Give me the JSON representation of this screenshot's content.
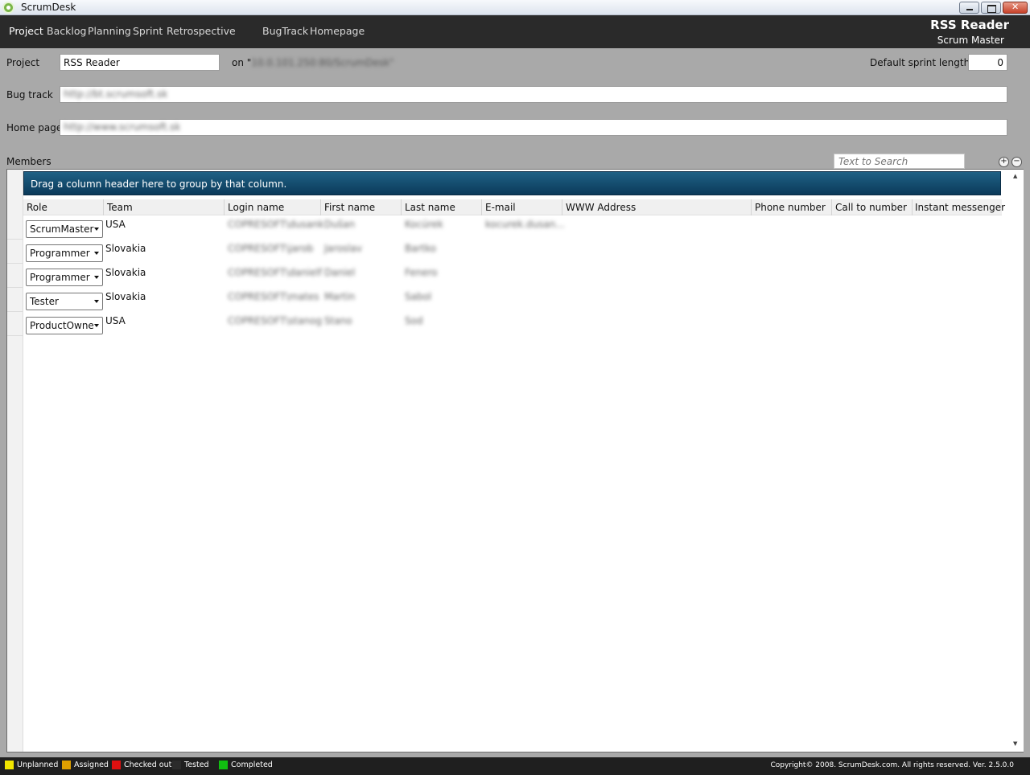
{
  "window": {
    "title": "ScrumDesk"
  },
  "nav": {
    "items": [
      "Project",
      "Backlog",
      "Planning",
      "Sprint",
      "Retrospective",
      "BugTrack",
      "Homepage"
    ],
    "active": "Project",
    "project_name": "RSS Reader",
    "user_role": "Scrum Master"
  },
  "form": {
    "project_label": "Project",
    "project_value": "RSS Reader",
    "on_label": "on \"",
    "server_value": "10.0.101.250:80/ScrumDesk\"",
    "sprint_length_label": "Default sprint length",
    "sprint_length_value": "0",
    "bugtrack_label": "Bug track",
    "bugtrack_value": "http://bt.scrumsoft.sk",
    "homepage_label": "Home page",
    "homepage_value": "http://www.scrumsoft.sk",
    "members_label": "Members"
  },
  "search": {
    "placeholder": "Text to Search"
  },
  "grid": {
    "group_hint": "Drag a column header here to group by that column.",
    "columns": [
      "Role",
      "Team",
      "Login name",
      "First name",
      "Last name",
      "E-mail",
      "WWW Address",
      "Phone number",
      "Call to number",
      "Instant messenger"
    ],
    "rows": [
      {
        "role": "ScrumMaster",
        "team": "USA",
        "login": "COPRESOFT\\dusank",
        "first": "Dušan",
        "last": "Kocúrek",
        "email": "kocurek.dusan..."
      },
      {
        "role": "Programmer",
        "team": "Slovakia",
        "login": "COPRESOFT\\jarob",
        "first": "Jaroslav",
        "last": "Bartko",
        "email": ""
      },
      {
        "role": "Programmer",
        "team": "Slovakia",
        "login": "COPRESOFT\\danielf",
        "first": "Daniel",
        "last": "Fenero",
        "email": ""
      },
      {
        "role": "Tester",
        "team": "Slovakia",
        "login": "COPRESOFT\\mates",
        "first": "Martin",
        "last": "Sabol",
        "email": ""
      },
      {
        "role": "ProductOwne",
        "team": "USA",
        "login": "COPRESOFT\\stanog",
        "first": "Stano",
        "last": "Sod",
        "email": ""
      }
    ]
  },
  "status": {
    "legend": [
      {
        "label": "Unplanned",
        "color": "#f2e600"
      },
      {
        "label": "Assigned",
        "color": "#e0a000"
      },
      {
        "label": "Checked out",
        "color": "#e01010"
      },
      {
        "label": "Tested",
        "color": "#2b2b2b"
      },
      {
        "label": "Completed",
        "color": "#10c010"
      }
    ],
    "copyright": "Copyright© 2008. ScrumDesk.com. All rights reserved. Ver. 2.5.0.0"
  }
}
